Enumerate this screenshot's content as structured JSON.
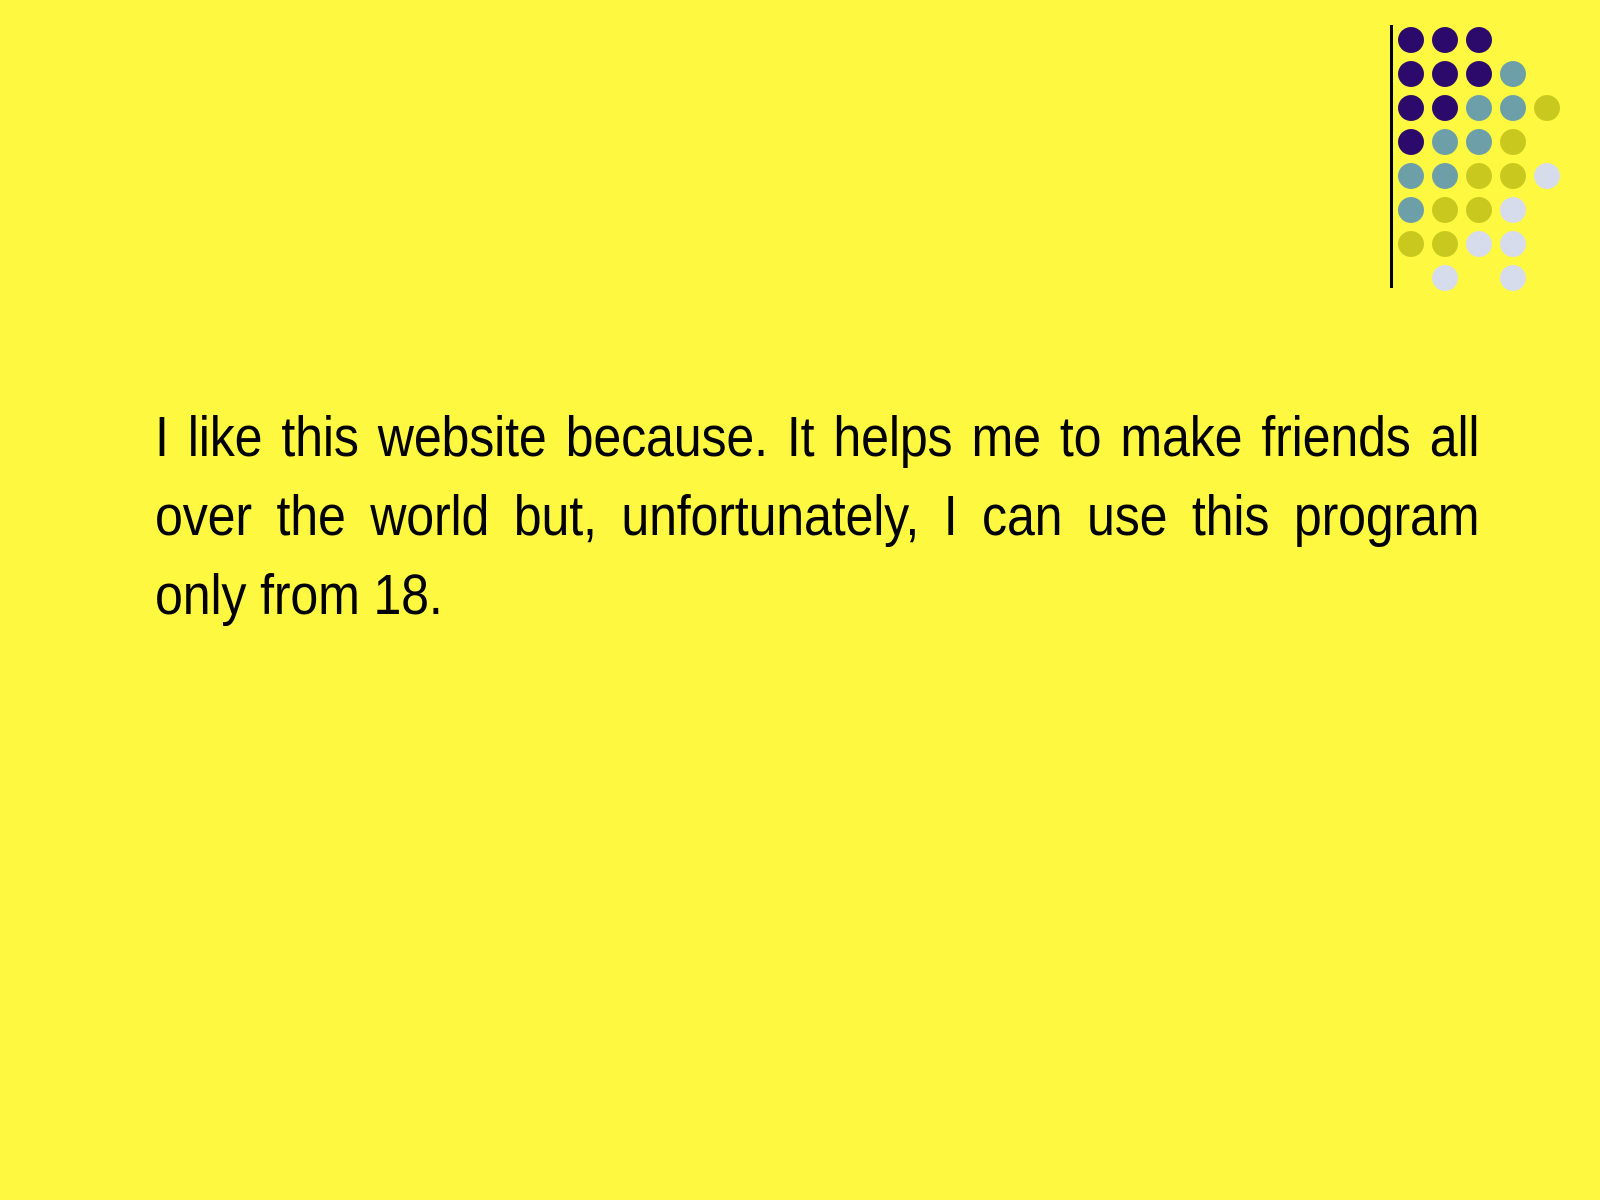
{
  "slide": {
    "background_color": "#FFF840",
    "body_text": "I like this website because. It helps me to make friends all over the world but, unfortunately, I can use this program only from 18.",
    "text_color": "#000000"
  },
  "logo": {
    "name": "dot-grid-logo",
    "rule_color": "#000000",
    "palette": {
      "navy": "#2B0A6B",
      "teal": "#6C9FA8",
      "olive": "#C8C81E",
      "lavender": "#D7DCEC"
    },
    "dot_diameter": 26,
    "spacing": 34,
    "rows": [
      [
        "navy",
        "navy",
        "navy",
        null,
        null
      ],
      [
        "navy",
        "navy",
        "navy",
        "teal",
        null
      ],
      [
        "navy",
        "navy",
        "teal",
        "teal",
        "olive"
      ],
      [
        "navy",
        "teal",
        "teal",
        "olive",
        null
      ],
      [
        "teal",
        "teal",
        "olive",
        "olive",
        "lavender"
      ],
      [
        "teal",
        "olive",
        "olive",
        "lavender",
        null
      ],
      [
        "olive",
        "olive",
        "lavender",
        "lavender",
        null
      ],
      [
        null,
        "lavender",
        null,
        "lavender",
        null
      ]
    ]
  }
}
